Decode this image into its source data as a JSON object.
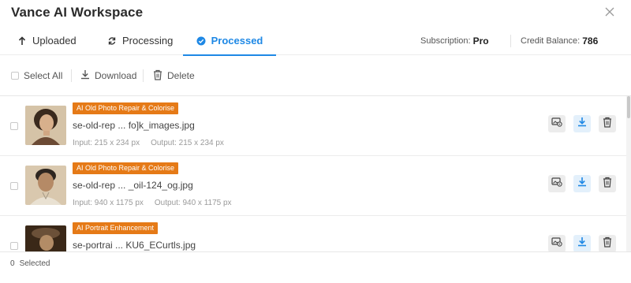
{
  "app": {
    "title": "Vance AI Workspace"
  },
  "tabs": [
    {
      "label": "Uploaded",
      "icon": "upload-arrow-icon"
    },
    {
      "label": "Processing",
      "icon": "refresh-icon"
    },
    {
      "label": "Processed",
      "icon": "check-circle-icon",
      "active": true
    }
  ],
  "subscription": {
    "label": "Subscription:",
    "value": "Pro"
  },
  "credits": {
    "label": "Credit Balance:",
    "value": "786"
  },
  "toolbar": {
    "select_all": "Select All",
    "download": "Download",
    "delete": "Delete"
  },
  "items": [
    {
      "badge": "AI Old Photo Repair & Colorise",
      "filename": "se-old-rep ... fo]k_images.jpg",
      "input": "Input: 215 x 234 px",
      "output": "Output: 215 x 234 px"
    },
    {
      "badge": "AI Old Photo Repair & Colorise",
      "filename": "se-old-rep ... _oil-124_og.jpg",
      "input": "Input: 940 x 1175 px",
      "output": "Output: 940 x 1175 px"
    },
    {
      "badge": "AI Portrait Enhancement",
      "filename": "se-portrai ... KU6_ECurtls.jpg",
      "input": "",
      "output": ""
    }
  ],
  "footer": {
    "count": "0",
    "label": "Selected"
  },
  "colors": {
    "accent": "#1e88e5",
    "badge": "#e57a17"
  }
}
